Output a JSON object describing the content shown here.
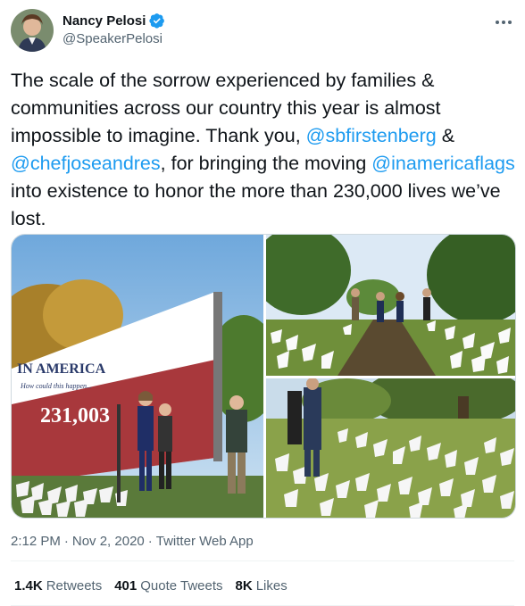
{
  "author": {
    "name": "Nancy Pelosi",
    "handle": "@SpeakerPelosi",
    "verified_icon": "verified-badge-icon",
    "avatar_icon": "avatar"
  },
  "tweet": {
    "segments": [
      {
        "t": "The scale of the sorrow experienced by families & communities across our country this year is almost impossible to imagine. Thank you, ",
        "link": false
      },
      {
        "t": "@sbfirstenberg",
        "link": true
      },
      {
        "t": " & ",
        "link": false
      },
      {
        "t": "@chefjoseandres",
        "link": true
      },
      {
        "t": ", for bringing the moving ",
        "link": false
      },
      {
        "t": "@inamericaflags",
        "link": true
      },
      {
        "t": " into existence to honor the more than 230,000 lives we’ve lost.",
        "link": false
      }
    ]
  },
  "media": {
    "photo1": {
      "billboard_title": "IN AMERICA",
      "billboard_sub": "How could this happen...",
      "billboard_number": "231,003"
    }
  },
  "meta": {
    "time": "2:12 PM",
    "dot1": "·",
    "date": "Nov 2, 2020",
    "dot2": "·",
    "source": "Twitter Web App"
  },
  "stats": {
    "retweets_count": "1.4K",
    "retweets_label": "Retweets",
    "quotes_count": "401",
    "quotes_label": "Quote Tweets",
    "likes_count": "8K",
    "likes_label": "Likes"
  },
  "colors": {
    "link": "#1d9bf0",
    "secondary": "#536471"
  }
}
